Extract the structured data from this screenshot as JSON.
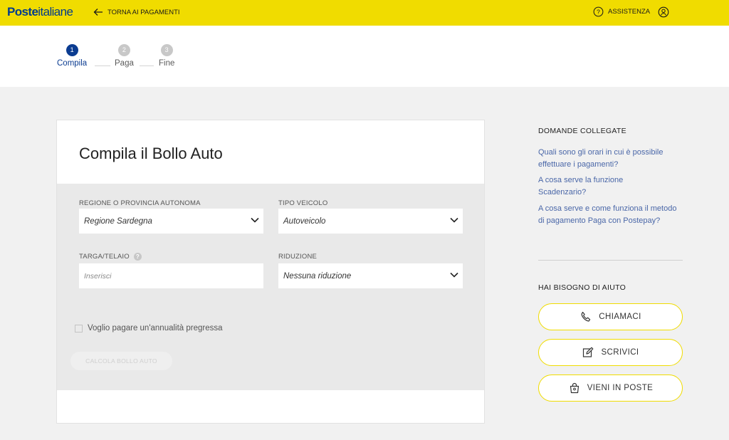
{
  "header": {
    "logo_bold": "Poste",
    "logo_rest": "italiane",
    "back_label": "TORNA AI PAGAMENTI",
    "assist_label": "ASSISTENZA",
    "brand_color": "#f0dc00",
    "icons": [
      "arrow-left-icon",
      "question-circle-icon",
      "user-icon"
    ]
  },
  "stepper": {
    "steps": [
      {
        "num": "1",
        "label": "Compila",
        "state": "active"
      },
      {
        "num": "2",
        "label": "Paga",
        "state": "inactive"
      },
      {
        "num": "3",
        "label": "Fine",
        "state": "inactive"
      }
    ],
    "active_color": "#0b3c91"
  },
  "form": {
    "title": "Compila il Bollo Auto",
    "regione": {
      "label": "REGIONE O PROVINCIA AUTONOMA",
      "value": "Regione Sardegna"
    },
    "tipo": {
      "label": "TIPO VEICOLO",
      "value": "Autoveicolo"
    },
    "targa": {
      "label": "TARGA/TELAIO",
      "placeholder": "Inserisci",
      "help_icon": "?"
    },
    "riduzione": {
      "label": "RIDUZIONE",
      "value": "Nessuna riduzione"
    },
    "checkbox_label": "Voglio pagare un'annualità pregressa",
    "submit_label": "CALCOLA BOLLO AUTO"
  },
  "sidebar": {
    "faq_heading": "DOMANDE COLLEGATE",
    "faqs": [
      "Quali sono gli orari in cui è possibile effettuare i pagamenti?",
      "A cosa serve la funzione Scadenzario?",
      "A cosa serve e come funziona il metodo di pagamento Paga con Postepay?"
    ],
    "help_heading": "HAI BISOGNO DI AIUTO",
    "help_buttons": [
      {
        "label": "CHIAMACI",
        "icon": "phone-icon"
      },
      {
        "label": "SCRIVICI",
        "icon": "edit-icon"
      },
      {
        "label": "VIENI IN POSTE",
        "icon": "location-bag-icon"
      }
    ]
  }
}
